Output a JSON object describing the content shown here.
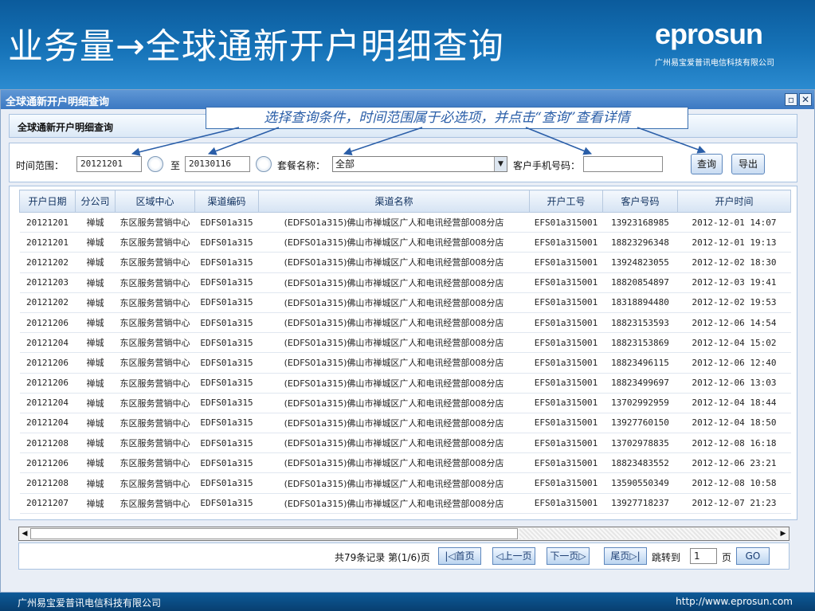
{
  "banner": {
    "title": "业务量→全球通新开户明细查询",
    "logo": "eprosun",
    "logo_sub": "广州易宝爱普讯电信科技有限公司"
  },
  "window": {
    "title": "全球通新开户明细查询",
    "panel_title": "全球通新开户明细查询",
    "close_icon": "close-icon",
    "restore_icon": "restore-icon"
  },
  "hint": "选择查询条件，时间范围属于必选项，并点击“查询”查看详情",
  "filter": {
    "time_label": "时间范围：",
    "start_date": "20121201",
    "to_label": "至",
    "end_date": "20130116",
    "package_label": "套餐名称：",
    "package_value": "全部",
    "phone_label": "客户手机号码：",
    "phone_value": "",
    "query_button": "查询",
    "export_button": "导出"
  },
  "table": {
    "columns": [
      "开户日期",
      "分公司",
      "区域中心",
      "渠道编码",
      "渠道名称",
      "开户工号",
      "客户号码",
      "开户时间"
    ],
    "rows": [
      [
        "20121201",
        "禅城",
        "东区服务营销中心",
        "EDFS01a315",
        "(EDFS01a315)佛山市禅城区广人和电讯经营部008分店",
        "EFS01a315001",
        "13923168985",
        "2012-12-01 14:07"
      ],
      [
        "20121201",
        "禅城",
        "东区服务营销中心",
        "EDFS01a315",
        "(EDFS01a315)佛山市禅城区广人和电讯经营部008分店",
        "EFS01a315001",
        "18823296348",
        "2012-12-01 19:13"
      ],
      [
        "20121202",
        "禅城",
        "东区服务营销中心",
        "EDFS01a315",
        "(EDFS01a315)佛山市禅城区广人和电讯经营部008分店",
        "EFS01a315001",
        "13924823055",
        "2012-12-02 18:30"
      ],
      [
        "20121203",
        "禅城",
        "东区服务营销中心",
        "EDFS01a315",
        "(EDFS01a315)佛山市禅城区广人和电讯经营部008分店",
        "EFS01a315001",
        "18820854897",
        "2012-12-03 19:41"
      ],
      [
        "20121202",
        "禅城",
        "东区服务营销中心",
        "EDFS01a315",
        "(EDFS01a315)佛山市禅城区广人和电讯经营部008分店",
        "EFS01a315001",
        "18318894480",
        "2012-12-02 19:53"
      ],
      [
        "20121206",
        "禅城",
        "东区服务营销中心",
        "EDFS01a315",
        "(EDFS01a315)佛山市禅城区广人和电讯经营部008分店",
        "EFS01a315001",
        "18823153593",
        "2012-12-06 14:54"
      ],
      [
        "20121204",
        "禅城",
        "东区服务营销中心",
        "EDFS01a315",
        "(EDFS01a315)佛山市禅城区广人和电讯经营部008分店",
        "EFS01a315001",
        "18823153869",
        "2012-12-04 15:02"
      ],
      [
        "20121206",
        "禅城",
        "东区服务营销中心",
        "EDFS01a315",
        "(EDFS01a315)佛山市禅城区广人和电讯经营部008分店",
        "EFS01a315001",
        "18823496115",
        "2012-12-06 12:40"
      ],
      [
        "20121206",
        "禅城",
        "东区服务营销中心",
        "EDFS01a315",
        "(EDFS01a315)佛山市禅城区广人和电讯经营部008分店",
        "EFS01a315001",
        "18823499697",
        "2012-12-06 13:03"
      ],
      [
        "20121204",
        "禅城",
        "东区服务营销中心",
        "EDFS01a315",
        "(EDFS01a315)佛山市禅城区广人和电讯经营部008分店",
        "EFS01a315001",
        "13702992959",
        "2012-12-04 18:44"
      ],
      [
        "20121204",
        "禅城",
        "东区服务营销中心",
        "EDFS01a315",
        "(EDFS01a315)佛山市禅城区广人和电讯经营部008分店",
        "EFS01a315001",
        "13927760150",
        "2012-12-04 18:50"
      ],
      [
        "20121208",
        "禅城",
        "东区服务营销中心",
        "EDFS01a315",
        "(EDFS01a315)佛山市禅城区广人和电讯经营部008分店",
        "EFS01a315001",
        "13702978835",
        "2012-12-08 16:18"
      ],
      [
        "20121206",
        "禅城",
        "东区服务营销中心",
        "EDFS01a315",
        "(EDFS01a315)佛山市禅城区广人和电讯经营部008分店",
        "EFS01a315001",
        "18823483552",
        "2012-12-06 23:21"
      ],
      [
        "20121208",
        "禅城",
        "东区服务营销中心",
        "EDFS01a315",
        "(EDFS01a315)佛山市禅城区广人和电讯经营部008分店",
        "EFS01a315001",
        "13590550349",
        "2012-12-08 10:58"
      ],
      [
        "20121207",
        "禅城",
        "东区服务营销中心",
        "EDFS01a315",
        "(EDFS01a315)佛山市禅城区广人和电讯经营部008分店",
        "EFS01a315001",
        "13927718237",
        "2012-12-07 21:23"
      ]
    ]
  },
  "pager": {
    "summary": "共79条记录 第(1/6)页",
    "first": "|◁首页",
    "prev": "◁上一页",
    "next": "下一页▷",
    "last": "尾页▷|",
    "jump_label": "跳转到",
    "page_value": "1",
    "page_unit": "页",
    "go_button": "GO"
  },
  "footer": {
    "company": "广州易宝爱普讯电信科技有限公司",
    "url": "http://www.eprosun.com"
  }
}
